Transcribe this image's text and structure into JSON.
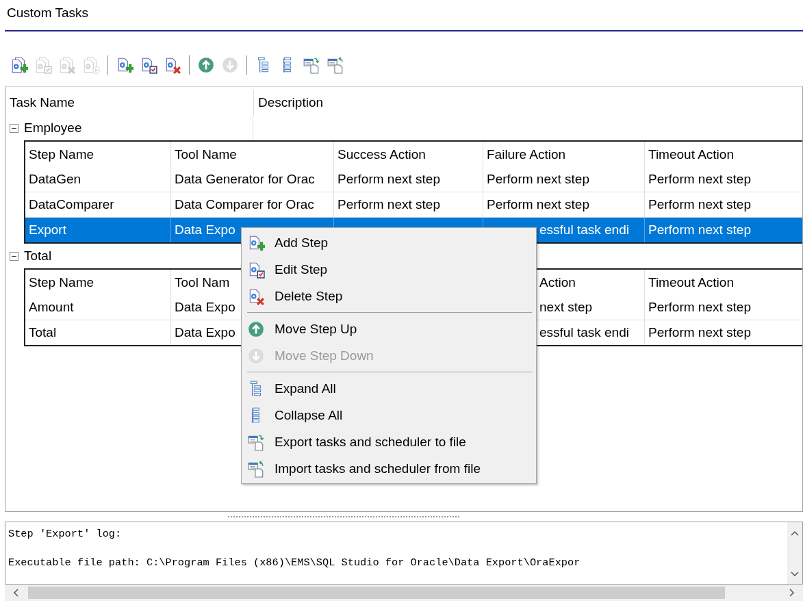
{
  "window": {
    "title": "Custom Tasks"
  },
  "toolbar": [
    {
      "kind": "task-add",
      "disabled": false
    },
    {
      "kind": "task-edit",
      "disabled": true
    },
    {
      "kind": "task-delete",
      "disabled": true
    },
    {
      "kind": "task-run",
      "disabled": true
    },
    {
      "kind": "separator"
    },
    {
      "kind": "step-add",
      "disabled": false
    },
    {
      "kind": "step-edit",
      "disabled": false
    },
    {
      "kind": "step-delete",
      "disabled": false
    },
    {
      "kind": "separator"
    },
    {
      "kind": "up",
      "disabled": false
    },
    {
      "kind": "down",
      "disabled": true
    },
    {
      "kind": "separator"
    },
    {
      "kind": "expand",
      "disabled": false
    },
    {
      "kind": "collapse",
      "disabled": false
    },
    {
      "kind": "export",
      "disabled": false
    },
    {
      "kind": "import",
      "disabled": false
    }
  ],
  "grid": {
    "columns": [
      "Task Name",
      "Description"
    ],
    "groups": [
      {
        "name": "Employee",
        "expanded": true,
        "steps": {
          "columns": [
            "Step Name",
            "Tool Name",
            "Success Action",
            "Failure Action",
            "Timeout Action"
          ],
          "rows": [
            {
              "cells": [
                "DataGen",
                "Data Generator for Orac",
                "Perform next step",
                "Perform next step",
                "Perform next step"
              ],
              "selected": false
            },
            {
              "cells": [
                "DataComparer",
                "Data Comparer for Orac",
                "Perform next step",
                "Perform next step",
                "Perform next step"
              ],
              "selected": false
            },
            {
              "cells": [
                "Export",
                "Data Expo",
                null,
                "essful task endi",
                "Perform next step"
              ],
              "failure_cut": true,
              "selected": true
            }
          ]
        }
      },
      {
        "name": "Total",
        "expanded": true,
        "steps": {
          "columns": [
            "Step Name",
            "Tool Nam",
            null,
            "Action",
            "Timeout Action"
          ],
          "failure_header_cut": true,
          "rows": [
            {
              "cells": [
                "Amount",
                "Data Expo",
                null,
                "next step",
                "Perform next step"
              ],
              "failure_cut": true,
              "selected": false
            },
            {
              "cells": [
                "Total",
                "Data Expo",
                null,
                "essful task endi",
                "Perform next step"
              ],
              "failure_cut": true,
              "selected": false
            }
          ]
        }
      }
    ]
  },
  "context_menu": {
    "items": [
      {
        "kind": "add",
        "label": "Add Step",
        "disabled": false
      },
      {
        "kind": "edit",
        "label": "Edit Step",
        "disabled": false
      },
      {
        "kind": "delete",
        "label": "Delete Step",
        "disabled": false
      },
      {
        "kind": "separator"
      },
      {
        "kind": "up",
        "label": "Move Step Up",
        "disabled": false
      },
      {
        "kind": "down",
        "label": "Move Step Down",
        "disabled": true
      },
      {
        "kind": "separator"
      },
      {
        "kind": "expand",
        "label": "Expand All",
        "disabled": false
      },
      {
        "kind": "collapse",
        "label": "Collapse All",
        "disabled": false
      },
      {
        "kind": "export",
        "label": "Export tasks and scheduler to file",
        "disabled": false
      },
      {
        "kind": "import",
        "label": "Import tasks and scheduler from file",
        "disabled": false
      }
    ]
  },
  "log": {
    "lines": [
      "Step 'Export' log:",
      "Executable file path: C:\\Program Files (x86)\\EMS\\SQL Studio for Oracle\\Data Export\\OraExpor"
    ]
  }
}
